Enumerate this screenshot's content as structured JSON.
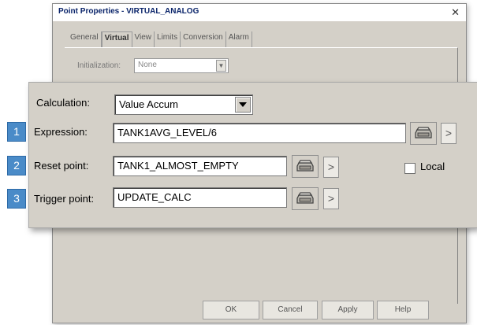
{
  "dialog": {
    "title": "Point Properties - VIRTUAL_ANALOG",
    "close_glyph": "✕",
    "tabs": [
      {
        "label": "General"
      },
      {
        "label": "Virtual"
      },
      {
        "label": "View"
      },
      {
        "label": "Limits"
      },
      {
        "label": "Conversion"
      },
      {
        "label": "Alarm"
      }
    ],
    "initialization": {
      "label": "Initialization:",
      "value": "None"
    },
    "buttons": {
      "ok": "OK",
      "cancel": "Cancel",
      "apply": "Apply",
      "help": "Help"
    }
  },
  "panel": {
    "calculation": {
      "label": "Calculation:",
      "value": "Value Accum"
    },
    "expression": {
      "number": "1",
      "label": "Expression:",
      "value": "TANK1AVG_LEVEL/6"
    },
    "reset_point": {
      "number": "2",
      "label": "Reset point:",
      "value": "TANK1_ALMOST_EMPTY"
    },
    "trigger_point": {
      "number": "3",
      "label": "Trigger point:",
      "value": "UPDATE_CALC"
    },
    "local": {
      "label": "Local",
      "checked": false
    },
    "arrow_glyph": ">"
  },
  "colors": {
    "number_badge": "#4a8bc8",
    "title_text": "#0a246a",
    "panel_bg": "#d4d0c8"
  }
}
